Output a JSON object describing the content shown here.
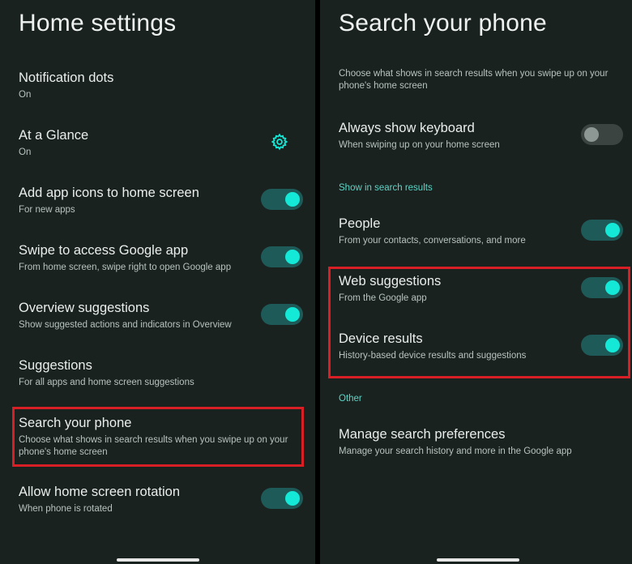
{
  "home_settings": {
    "title": "Home settings",
    "items": [
      {
        "title": "Notification dots",
        "subtitle": "On"
      },
      {
        "title": "At a Glance",
        "subtitle": "On",
        "icon": "gear-icon"
      },
      {
        "title": "Add app icons to home screen",
        "subtitle": "For new apps",
        "toggle": "on"
      },
      {
        "title": "Swipe to access Google app",
        "subtitle": "From home screen, swipe right to open Google app",
        "toggle": "on"
      },
      {
        "title": "Overview suggestions",
        "subtitle": "Show suggested actions and indicators in Overview",
        "toggle": "on"
      },
      {
        "title": "Suggestions",
        "subtitle": "For all apps and home screen suggestions"
      },
      {
        "title": "Search your phone",
        "subtitle": "Choose what shows in search results when you swipe up on your phone's home screen",
        "highlighted": true
      },
      {
        "title": "Allow home screen rotation",
        "subtitle": "When phone is rotated",
        "toggle": "on"
      }
    ]
  },
  "search_your_phone": {
    "title": "Search your phone",
    "description": "Choose what shows in search results when you swipe up on your phone's home screen",
    "always_show_keyboard": {
      "title": "Always show keyboard",
      "subtitle": "When swiping up on your home screen",
      "toggle": "off"
    },
    "section_show_in_results": "Show in search results",
    "people": {
      "title": "People",
      "subtitle": "From your contacts, conversations, and more",
      "toggle": "on"
    },
    "web_suggestions": {
      "title": "Web suggestions",
      "subtitle": "From the Google app",
      "toggle": "on"
    },
    "device_results": {
      "title": "Device results",
      "subtitle": "History-based device results and suggestions",
      "toggle": "on"
    },
    "section_other": "Other",
    "manage_search": {
      "title": "Manage search preferences",
      "subtitle": "Manage your search history and more in the Google app"
    }
  },
  "colors": {
    "background": "#1a2220",
    "accent": "#14e8d6",
    "section_label": "#5ad6c6",
    "highlight": "#d81f26"
  }
}
